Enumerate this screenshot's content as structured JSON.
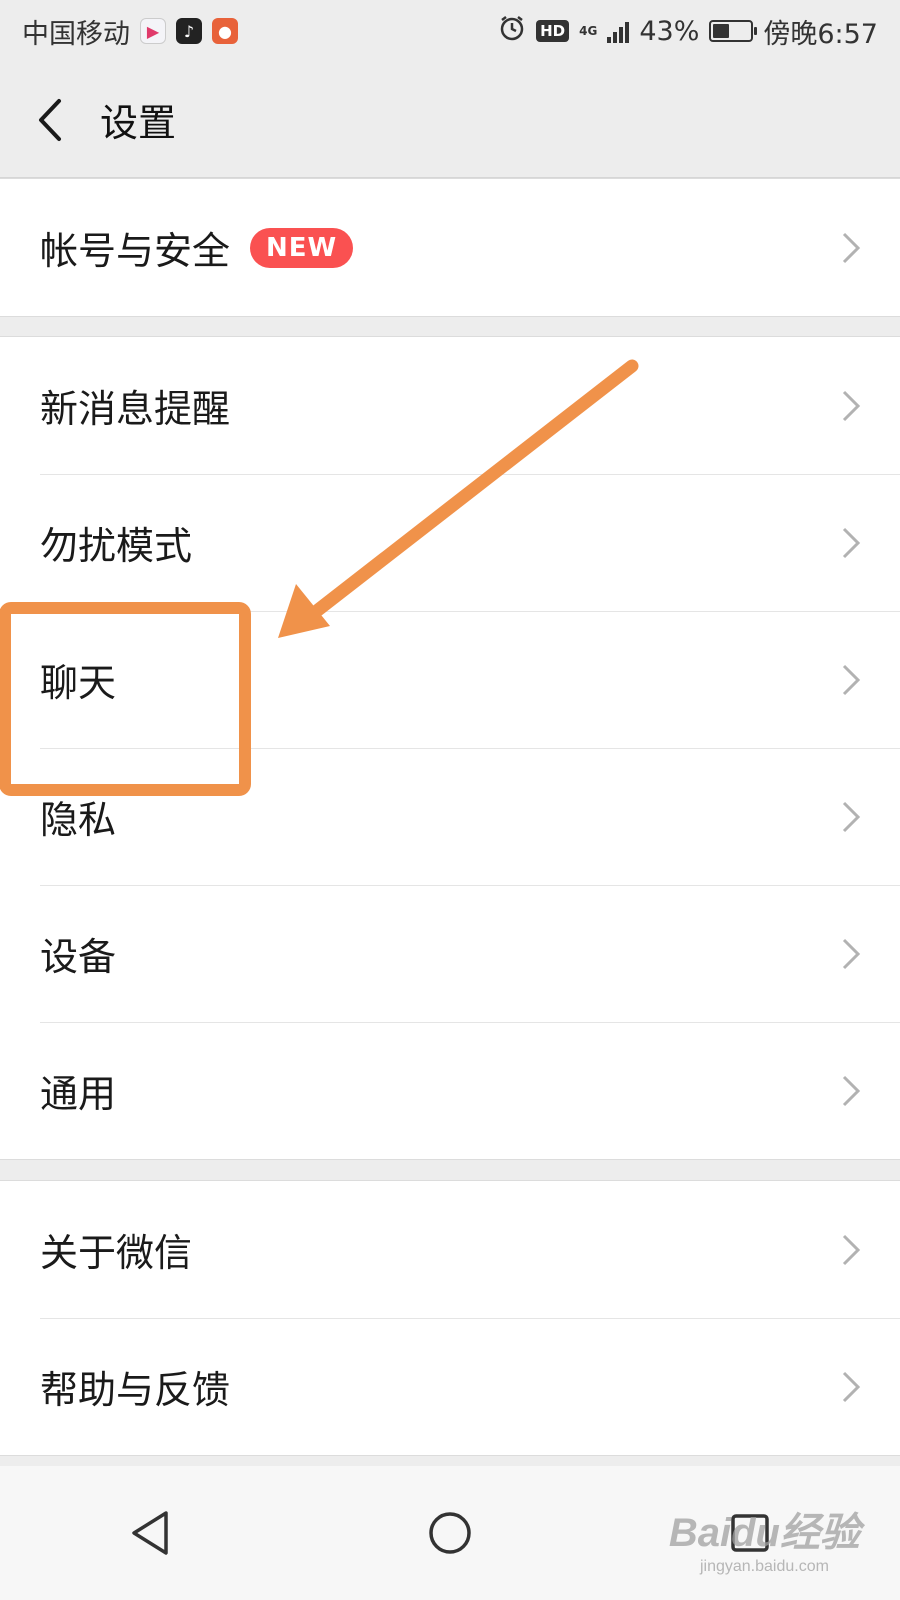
{
  "status_bar": {
    "carrier": "中国移动",
    "app_icons": [
      "video-app-icon",
      "tiktok-icon",
      "app-icon"
    ],
    "hd": "HD",
    "network": "4G",
    "battery_percent": "43%",
    "battery_level": 0.43,
    "time": "傍晚6:57"
  },
  "header": {
    "title": "设置"
  },
  "groups": [
    {
      "items": [
        {
          "label": "帐号与安全",
          "badge": "NEW"
        }
      ]
    },
    {
      "items": [
        {
          "label": "新消息提醒"
        },
        {
          "label": "勿扰模式"
        },
        {
          "label": "聊天"
        },
        {
          "label": "隐私"
        },
        {
          "label": "设备"
        },
        {
          "label": "通用"
        }
      ]
    },
    {
      "items": [
        {
          "label": "关于微信"
        },
        {
          "label": "帮助与反馈"
        }
      ]
    }
  ],
  "watermark": {
    "main": "Baidu经验",
    "sub": "jingyan.baidu.com"
  },
  "colors": {
    "background": "#ededed",
    "badge": "#fa5151",
    "annotation": "#f0924a"
  }
}
